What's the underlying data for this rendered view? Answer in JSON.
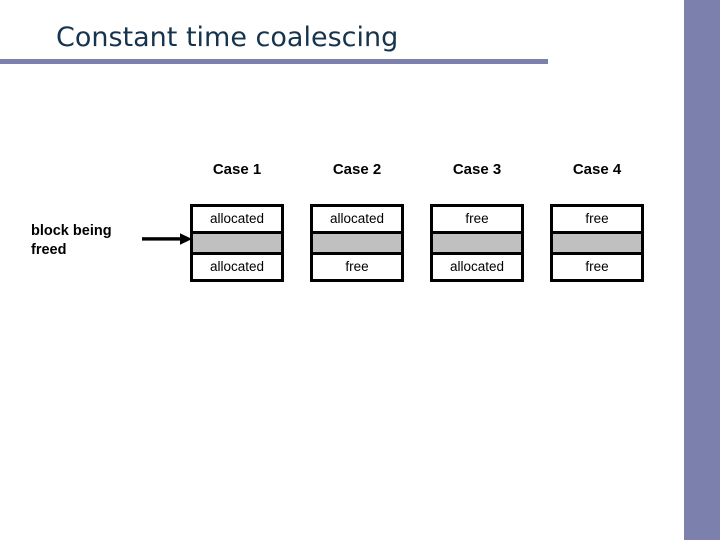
{
  "slide": {
    "title": "Constant time coalescing",
    "accent_color": "#7b80ad",
    "title_color": "#16344e",
    "block_fill_color": "#c0c0c0",
    "background_color": "#ffffff"
  },
  "caption": {
    "line1": "block being",
    "line2": "freed",
    "arrow": "right-arrow"
  },
  "cases": [
    {
      "label": "Case 1",
      "top_block": "allocated",
      "middle_block": "",
      "bottom_block": "allocated"
    },
    {
      "label": "Case 2",
      "top_block": "allocated",
      "middle_block": "",
      "bottom_block": "free"
    },
    {
      "label": "Case 3",
      "top_block": "free",
      "middle_block": "",
      "bottom_block": "allocated"
    },
    {
      "label": "Case 4",
      "top_block": "free",
      "middle_block": "",
      "bottom_block": "free"
    }
  ]
}
